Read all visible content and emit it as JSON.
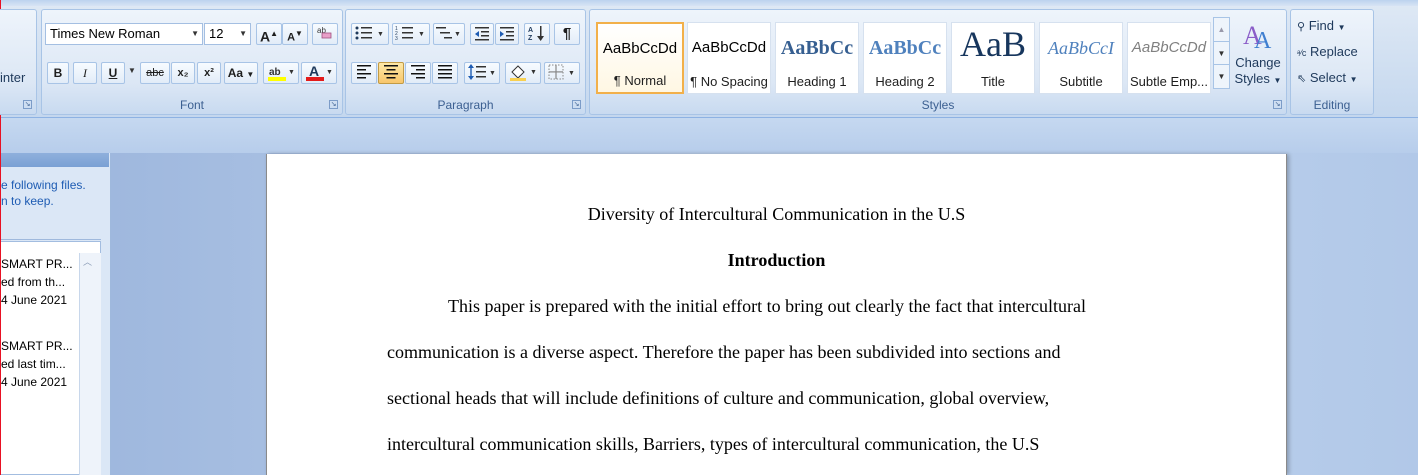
{
  "clipboard": {
    "format_painter_partial": "inter"
  },
  "font": {
    "name": "Times New Roman",
    "size": "12",
    "grow_label": "A",
    "shrink_label": "A",
    "bold": "B",
    "italic": "I",
    "underline": "U",
    "strike": "abc",
    "subscript": "x₂",
    "superscript": "x²",
    "case": "Aa",
    "font_color": "A",
    "group_label": "Font",
    "highlight_color": "#ffff00",
    "text_color": "#e31b1b"
  },
  "paragraph": {
    "group_label": "Paragraph"
  },
  "styles": {
    "group_label": "Styles",
    "tiles": [
      {
        "sample": "AaBbCcDd",
        "name": "¶ Normal"
      },
      {
        "sample": "AaBbCcDd",
        "name": "¶ No Spacing"
      },
      {
        "sample": "AaBbCc",
        "name": "Heading 1"
      },
      {
        "sample": "AaBbCc",
        "name": "Heading 2"
      },
      {
        "sample": "AaB",
        "name": "Title"
      },
      {
        "sample": "AaBbCcI",
        "name": "Subtitle"
      },
      {
        "sample": "AaBbCcDd",
        "name": "Subtle Emp..."
      }
    ],
    "change_styles_line1": "Change",
    "change_styles_line2": "Styles"
  },
  "editing": {
    "group_label": "Editing",
    "find": "Find",
    "replace": "Replace",
    "select": "Select"
  },
  "recovery": {
    "message_line1": "e following files.",
    "message_line2": "n to keep.",
    "files": [
      {
        "name": "SMART PR...",
        "status": "ed from th...",
        "date": "4 June 2021"
      },
      {
        "name": "SMART PR...",
        "status": "ed last tim...",
        "date": "4 June 2021"
      }
    ]
  },
  "document": {
    "title": "Diversity of Intercultural Communication in the U.S",
    "heading": "Introduction",
    "lines": [
      "This paper is prepared with the initial effort to bring out clearly the fact that intercultural",
      "communication is a diverse aspect. Therefore the paper has been subdivided into sections and",
      "sectional heads that will include definitions of culture and communication, global overview,",
      "intercultural communication skills, Barriers, types of intercultural communication, the U.S"
    ]
  }
}
